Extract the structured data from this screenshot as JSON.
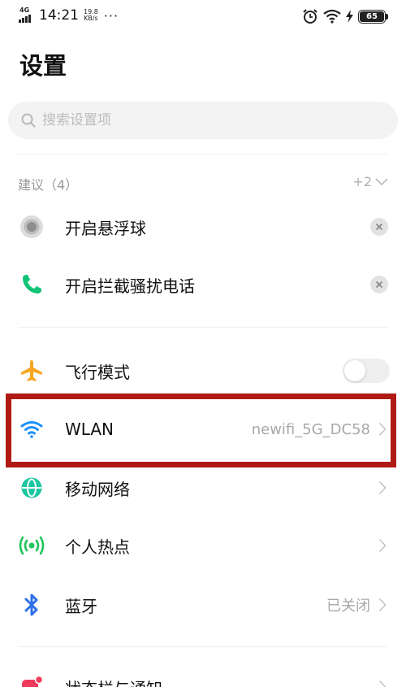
{
  "status_bar": {
    "network": "4G",
    "time": "14:21",
    "speed_value": "19.8",
    "speed_unit": "KB/s",
    "more": "···",
    "battery": "65"
  },
  "title": "设置",
  "search": {
    "placeholder": "搜索设置项"
  },
  "suggestions": {
    "title": "建议（4）",
    "more": "+2",
    "items": [
      {
        "label": "开启悬浮球",
        "icon": "floating-ball-icon"
      },
      {
        "label": "开启拦截骚扰电话",
        "icon": "phone-icon"
      }
    ]
  },
  "settings": [
    {
      "label": "飞行模式",
      "icon": "airplane-icon",
      "type": "toggle",
      "on": false
    },
    {
      "label": "WLAN",
      "icon": "wifi-icon",
      "value": "newifi_5G_DC58",
      "type": "link"
    },
    {
      "label": "移动网络",
      "icon": "globe-icon",
      "type": "link"
    },
    {
      "label": "个人热点",
      "icon": "hotspot-icon",
      "type": "link"
    },
    {
      "label": "蓝牙",
      "icon": "bluetooth-icon",
      "value": "已关闭",
      "type": "link"
    },
    {
      "label": "状态栏与通知",
      "icon": "notification-icon",
      "type": "link"
    }
  ],
  "colors": {
    "highlight": "#b01a14",
    "airplane": "#f5a623",
    "wifi": "#1e90ff",
    "globe": "#1cc7a0",
    "hotspot": "#21c45a",
    "bluetooth": "#2f6fe8",
    "phone": "#12c476",
    "notification": "#ee3b5b"
  }
}
